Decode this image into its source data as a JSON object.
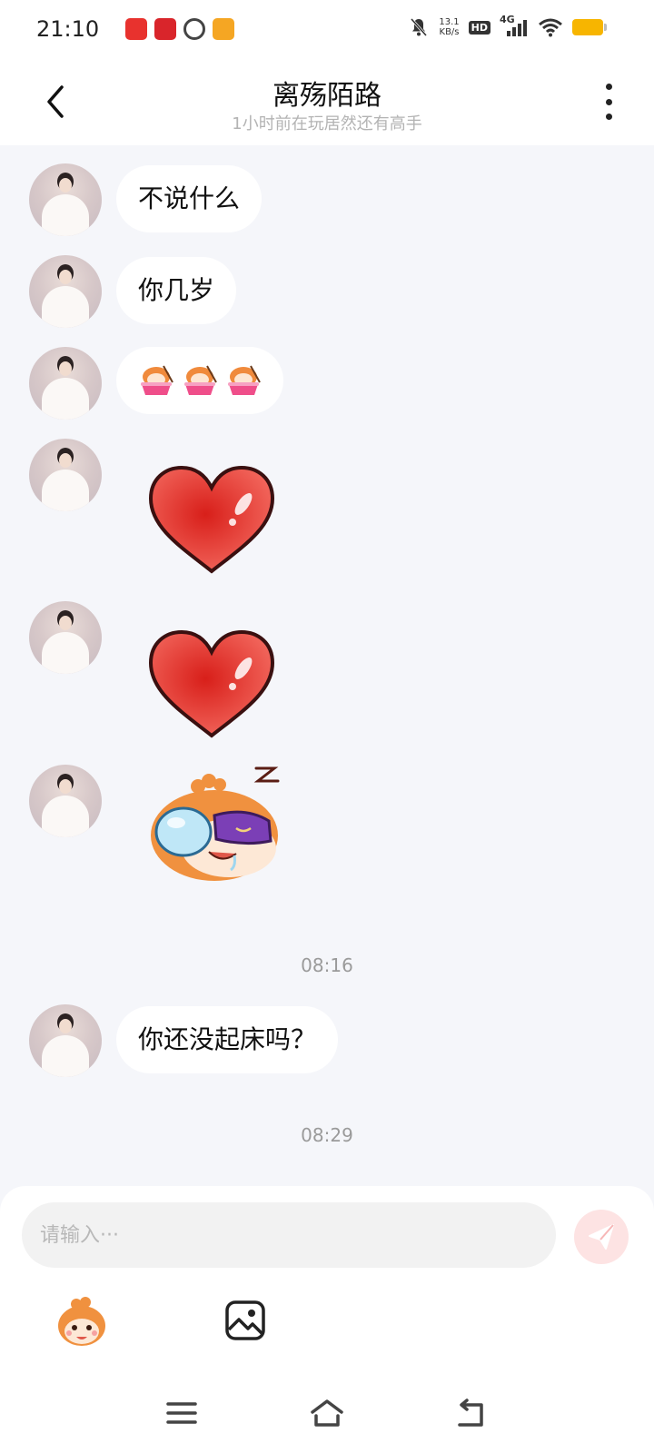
{
  "status_bar": {
    "time": "21:10",
    "net_speed_value": "13.1",
    "net_speed_unit": "KB/s",
    "hd": "HD",
    "signal": "4G",
    "battery_color": "#f7b500"
  },
  "header": {
    "title": "离殇陌路",
    "subtitle": "1小时前在玩居然还有高手"
  },
  "messages": [
    {
      "type": "text",
      "text": "不说什么"
    },
    {
      "type": "text",
      "text": "你几岁"
    },
    {
      "type": "emoji_row",
      "emoji": "monkey-noodle-emoji",
      "count": 3
    },
    {
      "type": "sticker",
      "sticker": "red-heart-sticker"
    },
    {
      "type": "sticker",
      "sticker": "red-heart-sticker"
    },
    {
      "type": "sticker",
      "sticker": "sleeping-monkey-sticker"
    },
    {
      "type": "time",
      "text": "08:16"
    },
    {
      "type": "text",
      "text": "你还没起床吗？"
    },
    {
      "type": "time",
      "text": "08:29"
    }
  ],
  "composer": {
    "placeholder": "请输入···",
    "send_icon": "send-icon",
    "tools": [
      "monkey-emoji-icon",
      "image-icon"
    ]
  },
  "colors": {
    "background": "#f5f6fa",
    "bubble": "#ffffff",
    "heart": "#e8342c",
    "send_button": "#fde3e3"
  }
}
